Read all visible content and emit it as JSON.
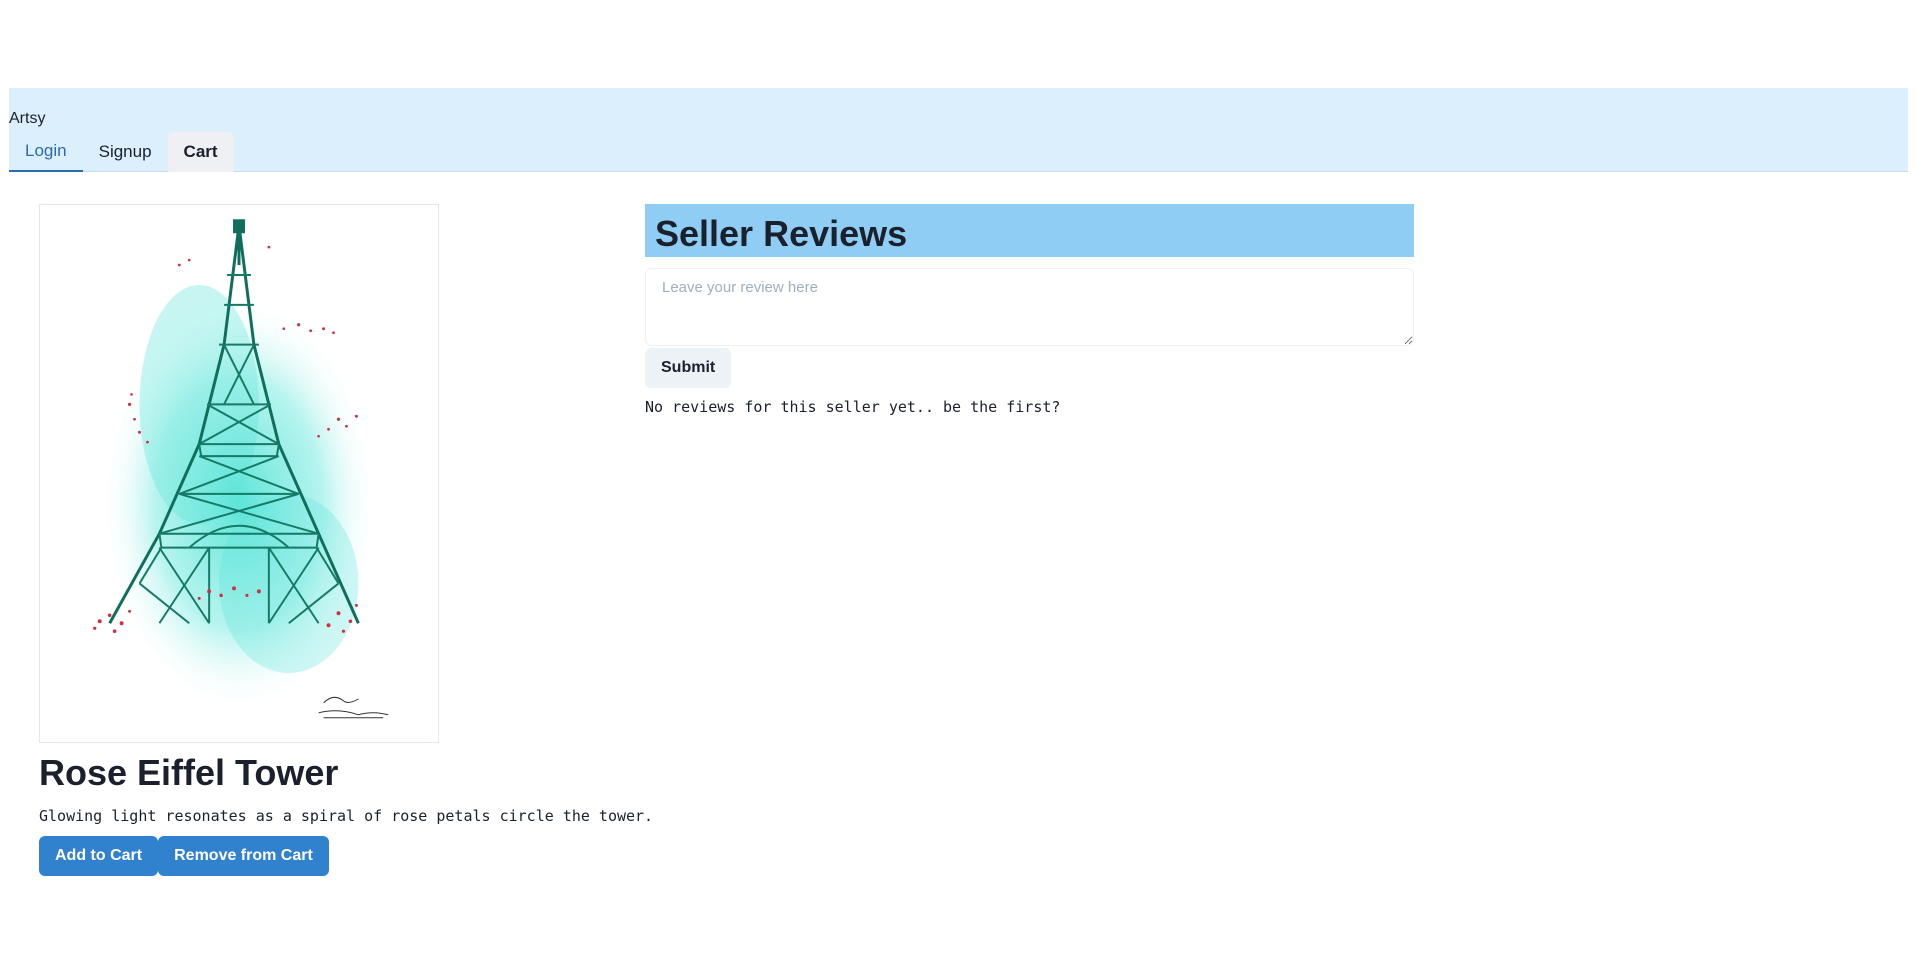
{
  "navbar": {
    "brand": "Artsy",
    "tabs": [
      {
        "label": "Login"
      },
      {
        "label": "Signup"
      },
      {
        "label": "Cart"
      }
    ]
  },
  "product": {
    "image_alt": "Rose Eiffel Tower painting",
    "image_signature": "Simone Hegg",
    "title": "Rose Eiffel Tower",
    "description": "Glowing light resonates as a spiral of rose petals circle the tower.",
    "add_to_cart_label": "Add to Cart",
    "remove_from_cart_label": "Remove from Cart"
  },
  "reviews": {
    "heading": "Seller Reviews",
    "input_placeholder": "Leave your review here",
    "input_value": "",
    "submit_label": "Submit",
    "empty_message": "No reviews for this seller yet.. be the first?"
  },
  "colors": {
    "navbar_bg": "#dbeffd",
    "accent": "#3182ce",
    "active_tab": "#2b6cb0",
    "reviews_header_bg": "#90cdf4",
    "tower": "#1f9e86",
    "petals": "#d0313f"
  }
}
